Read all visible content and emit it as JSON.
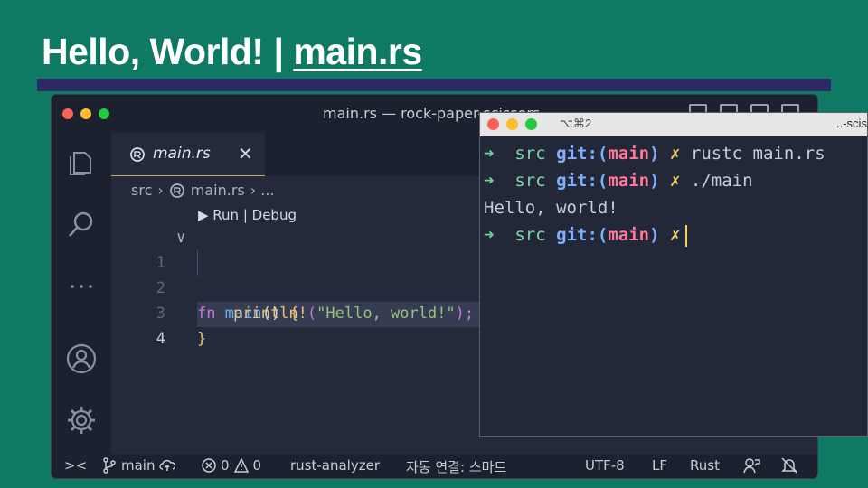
{
  "slide": {
    "title_prefix": "Hello, World! | ",
    "title_file": "main.rs"
  },
  "vscode": {
    "window_title": "main.rs — rock-paper-scissors",
    "tab": {
      "label": "main.rs",
      "close": "✕"
    },
    "breadcrumb": {
      "folder": "src",
      "sep": "›",
      "file": "main.rs",
      "more": "› ..."
    },
    "codelens": "▶ Run | Debug",
    "lines": [
      {
        "num": "1",
        "fold": "∨"
      },
      {
        "num": "2"
      },
      {
        "num": "3"
      },
      {
        "num": "4"
      }
    ],
    "code": {
      "l1_kw": "fn",
      "l1_name": " main",
      "l1_rest": "() ",
      "l1_brace": "{",
      "l2_macro": "println!",
      "l2_open": "(",
      "l2_str": "\"Hello, world!\"",
      "l2_close": ");",
      "l3_brace": "}"
    },
    "statusbar": {
      "remote": "><",
      "branch": "main",
      "errors": "0",
      "warnings": "0",
      "analyzer": "rust-analyzer",
      "autosave": "자동 연결: 스마트",
      "encoding": "UTF-8",
      "eol": "LF",
      "language": "Rust"
    }
  },
  "terminal": {
    "shortcut": "⌥⌘2",
    "title": "..-scis",
    "prompt_arrow": "➜",
    "prompt_dir": "src",
    "prompt_git": "git:",
    "prompt_branch_open": "(",
    "prompt_branch": "main",
    "prompt_branch_close": ")",
    "prompt_dirty": "✗",
    "cmd1": "rustc main.rs",
    "cmd2": "./main",
    "output": "Hello, world!"
  },
  "colors": {
    "background": "#0f7a63",
    "accent_bar": "#2e2a66",
    "editor_bg": "#242a3c",
    "terminal_bg": "#232838"
  }
}
